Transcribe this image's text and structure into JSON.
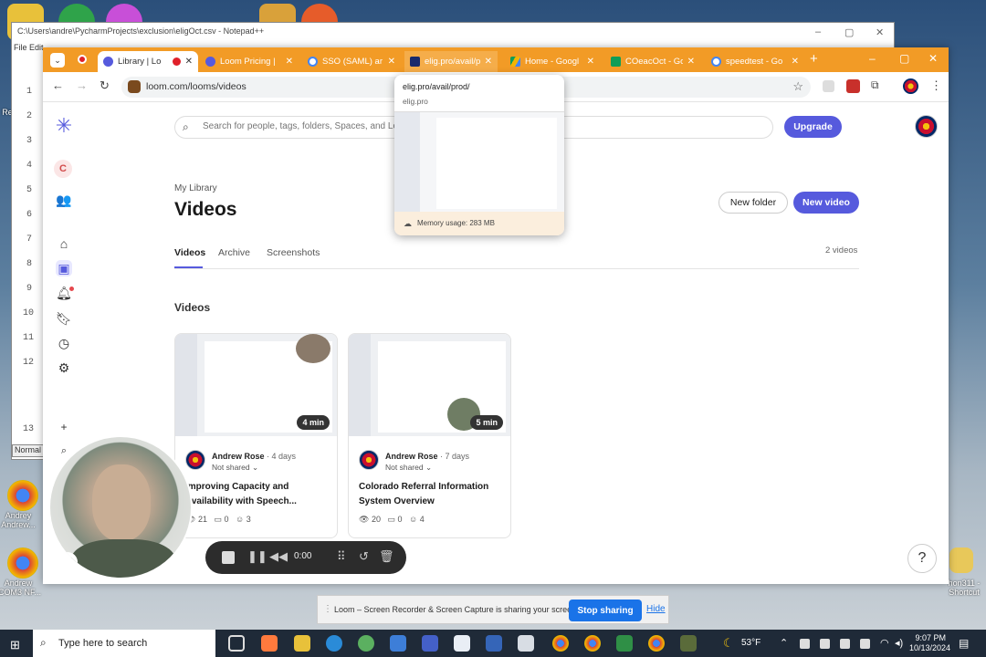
{
  "notepad": {
    "title": "C:\\Users\\andre\\PycharmProjects\\exclusion\\eligOct.csv - Notepad++",
    "menu": "File  Edit",
    "line_numbers": [
      "1",
      "2",
      "3",
      "4",
      "5",
      "6",
      "7",
      "8",
      "9",
      "10",
      "11",
      "12",
      "13"
    ],
    "status_mode": "Normal t"
  },
  "browser": {
    "tabs": [
      {
        "label": "Library | Lo",
        "active": true
      },
      {
        "label": "Loom Pricing |",
        "active": false
      },
      {
        "label": "SSO (SAML) ar",
        "active": false
      },
      {
        "label": "elig.pro/avail/p",
        "active": false
      },
      {
        "label": "Home - Googl",
        "active": false
      },
      {
        "label": "COeacOct - Go",
        "active": false
      },
      {
        "label": "speedtest - Go",
        "active": false
      }
    ],
    "new_tab": "+",
    "url": "loom.com/looms/videos"
  },
  "hover_card": {
    "title": "elig.pro/avail/prod/",
    "domain": "elig.pro",
    "memory": "Memory usage: 283 MB"
  },
  "loom": {
    "workspace_initial": "C",
    "search_placeholder": "Search for people, tags, folders, Spaces, and Lo",
    "upgrade_label": "Upgrade",
    "breadcrumb": "My Library",
    "page_title": "Videos",
    "tabs": [
      "Videos",
      "Archive",
      "Screenshots"
    ],
    "video_count": "2 videos",
    "new_folder_label": "New folder",
    "new_video_label": "New video",
    "section_title": "Videos",
    "videos": [
      {
        "duration": "4 min",
        "author": "Andrew Rose",
        "age": "· 4 days",
        "sharing": "Not shared",
        "title": "Improving Capacity and Availability with Speech...",
        "views": "21",
        "comments": "0",
        "reactions": "3"
      },
      {
        "duration": "5 min",
        "author": "Andrew Rose",
        "age": "· 7 days",
        "sharing": "Not shared",
        "title": "Colorado Referral Information System Overview",
        "views": "20",
        "comments": "0",
        "reactions": "4"
      }
    ],
    "add_label": "+"
  },
  "recorder": {
    "timer": "0:00"
  },
  "help_label": "?",
  "share_bar": {
    "text": "Loom – Screen Recorder & Screen Capture is sharing your screen.",
    "stop_label": "Stop sharing",
    "hide_label": "Hide"
  },
  "desktop_icons": [
    {
      "label": "Re"
    },
    {
      "label": "Andrey Andrew..."
    },
    {
      "label": "Andrew (COM3 NF..."
    },
    {
      "label": "hon311 - Shortcut"
    }
  ],
  "taskbar": {
    "search_placeholder": "Type here to search",
    "temperature": "53°F",
    "time": "9:07 PM",
    "date": "10/13/2024"
  },
  "colors": {
    "tab_bar": "#f29b26",
    "loom_purple": "#565ADD",
    "share_blue": "#1a73e8"
  }
}
